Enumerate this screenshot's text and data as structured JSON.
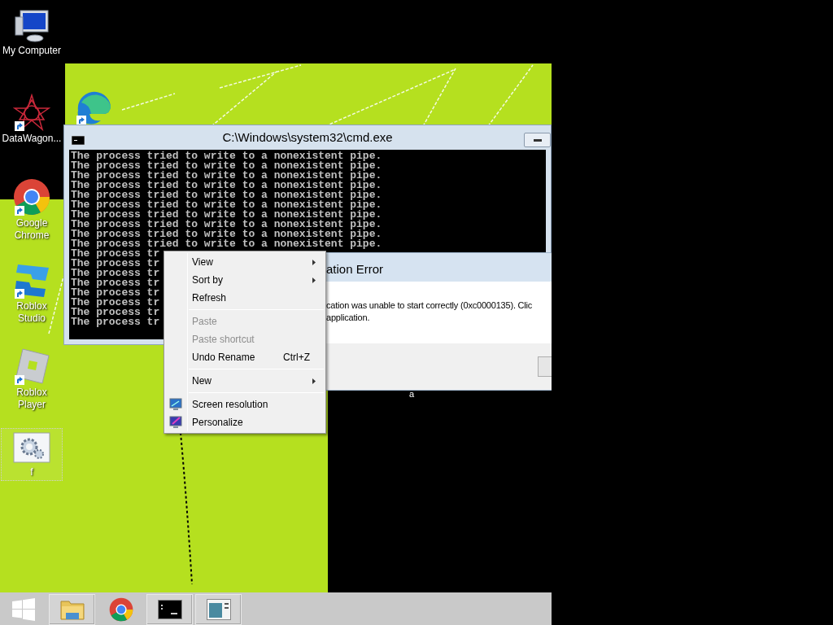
{
  "desktop_icons": [
    {
      "label": "My Computer",
      "kind": "computer",
      "shortcut": false,
      "selected": false
    },
    {
      "label": "DataWagon...",
      "kind": "star",
      "shortcut": true,
      "selected": false
    },
    {
      "label": "Google Chrome",
      "kind": "chrome",
      "shortcut": true,
      "selected": false
    },
    {
      "label": "Roblox Studio",
      "kind": "studio",
      "shortcut": true,
      "selected": false
    },
    {
      "label": "Roblox Player",
      "kind": "player",
      "shortcut": true,
      "selected": false
    },
    {
      "label": "f",
      "kind": "settings",
      "shortcut": false,
      "selected": true
    }
  ],
  "covered_icon": {
    "kind": "edge",
    "shortcut": true
  },
  "console_window": {
    "title": "C:\\Windows\\system32\\cmd.exe",
    "lines": [
      "The process tried to write to a nonexistent pipe.",
      "The process tried to write to a nonexistent pipe.",
      "The process tried to write to a nonexistent pipe.",
      "The process tried to write to a nonexistent pipe.",
      "The process tried to write to a nonexistent pipe.",
      "The process tried to write to a nonexistent pipe.",
      "The process tried to write to a nonexistent pipe.",
      "The process tried to write to a nonexistent pipe.",
      "The process tried to write to a nonexistent pipe.",
      "The process tried to write to a nonexistent pipe.",
      "The process tr",
      "The process tr",
      "The process tr",
      "The process tr",
      "The process tr",
      "The process tr",
      "The process tr",
      "The process tr"
    ]
  },
  "error_dialog": {
    "title": "ation Error",
    "message_lines": [
      "cation was unable to start correctly (0xc0000135). Clic",
      "application."
    ]
  },
  "stray_label": "a",
  "context_menu": {
    "items": [
      {
        "kind": "item",
        "label": "View",
        "submenu": true,
        "disabled": false
      },
      {
        "kind": "item",
        "label": "Sort by",
        "submenu": true,
        "disabled": false
      },
      {
        "kind": "item",
        "label": "Refresh",
        "submenu": false,
        "disabled": false
      },
      {
        "kind": "separator"
      },
      {
        "kind": "item",
        "label": "Paste",
        "submenu": false,
        "disabled": true
      },
      {
        "kind": "item",
        "label": "Paste shortcut",
        "submenu": false,
        "disabled": true
      },
      {
        "kind": "item",
        "label": "Undo Rename",
        "shortcut": "Ctrl+Z",
        "submenu": false,
        "disabled": false
      },
      {
        "kind": "separator"
      },
      {
        "kind": "item",
        "label": "New",
        "submenu": true,
        "disabled": false
      },
      {
        "kind": "separator"
      },
      {
        "kind": "monitor_item",
        "label": "Screen resolution",
        "submenu": false,
        "disabled": false
      },
      {
        "kind": "brush_item",
        "label": "Personalize",
        "submenu": false,
        "disabled": false
      }
    ]
  },
  "taskbar": {
    "items": [
      {
        "kind": "start",
        "open": false
      },
      {
        "kind": "folder",
        "open": true
      },
      {
        "kind": "chrome",
        "open": false
      },
      {
        "kind": "console",
        "open": true
      },
      {
        "kind": "window",
        "open": true
      }
    ]
  }
}
